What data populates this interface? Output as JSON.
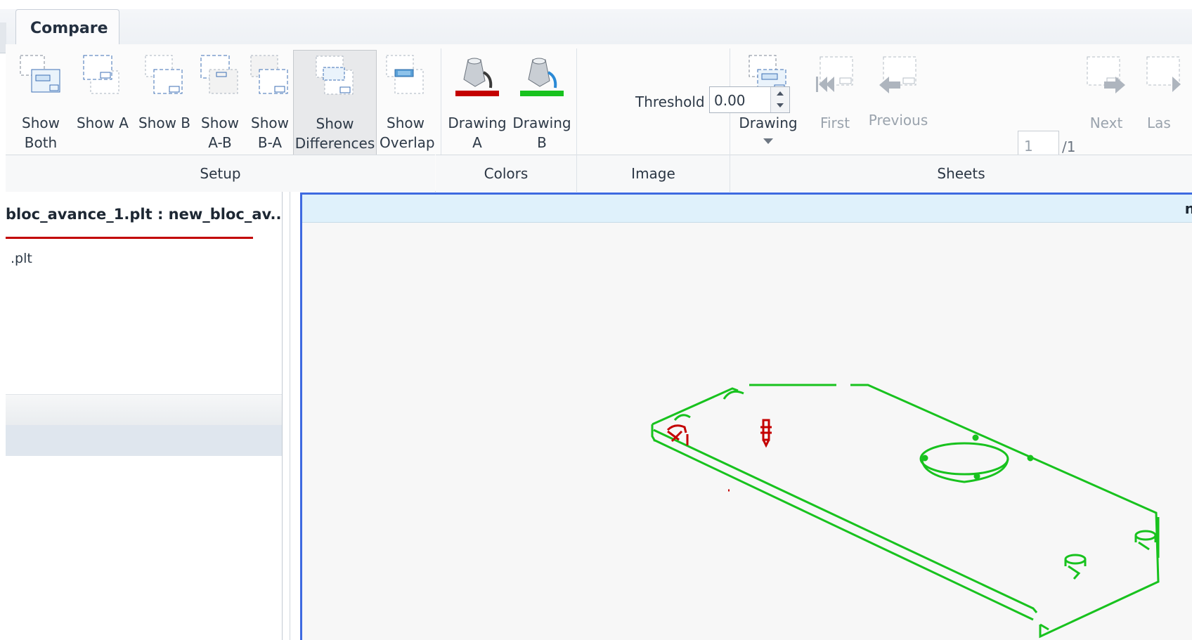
{
  "tab": {
    "label": "Compare"
  },
  "groups": {
    "setup": "Setup",
    "colors": "Colors",
    "image": "Image",
    "sheets": "Sheets"
  },
  "setup": {
    "show_both": "Show\nBoth",
    "show_a": "Show A",
    "show_b": "Show B",
    "show_a_b": "Show\nA-B",
    "show_b_a": "Show\nB-A",
    "show_differences": "Show\nDifferences",
    "show_overlap": "Show\nOverlap"
  },
  "colors": {
    "drawing_a": "Drawing\nA",
    "drawing_b": "Drawing\nB",
    "drawing_a_color": "#c40000",
    "drawing_b_color": "#18c21e"
  },
  "image": {
    "threshold_label": "Threshold",
    "threshold_value": "0.00"
  },
  "sheets": {
    "drawing": "Drawing",
    "first": "First",
    "previous": "Previous",
    "page_value": "1",
    "page_total": "/1",
    "next": "Next",
    "last": "Las"
  },
  "left_panel": {
    "title": "bloc_avance_1.plt : new_bloc_av...",
    "file": ".plt"
  },
  "canvas": {
    "header_text": "n"
  }
}
